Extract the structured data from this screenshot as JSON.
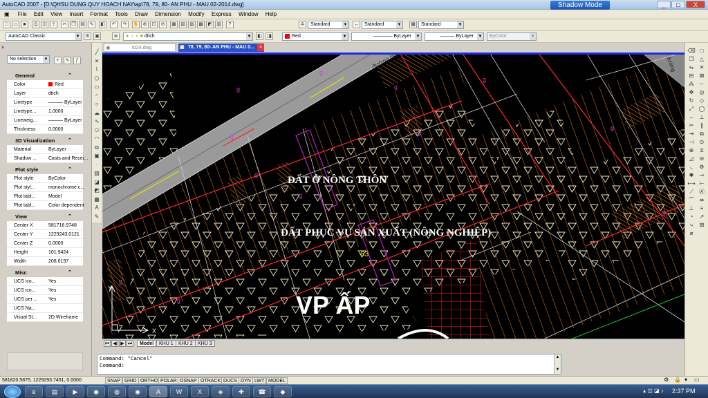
{
  "window": {
    "title": "AutoCAD 2007 - [D:\\QHSU DUNG QUY HOACH NAY\\ap\\78, 79, 80- AN PHU - MAU 02-2014.dwg]",
    "overlay": "Shadow Mode",
    "controls": [
      "_",
      "□",
      "X"
    ]
  },
  "menu": [
    "File",
    "Edit",
    "View",
    "Insert",
    "Format",
    "Tools",
    "Draw",
    "Dimension",
    "Modify",
    "Express",
    "Window",
    "Help"
  ],
  "toolbar1": {
    "text_style": "Standard",
    "dim_style": "Standard",
    "table_style": "Standard"
  },
  "toolbar2": {
    "workspace": "AutoCAD Classic",
    "layer": "dtich",
    "color": "Red",
    "linetype": "ByLayer",
    "lineweight": "ByLayer",
    "plotstyle": "ByColor"
  },
  "properties": {
    "selection": "No selection",
    "sections": [
      {
        "title": "General",
        "rows": [
          {
            "k": "Color",
            "v": "Red",
            "swatch": "#ff0000"
          },
          {
            "k": "Layer",
            "v": "dtich"
          },
          {
            "k": "Linetype",
            "v": "ByLayer",
            "line": true
          },
          {
            "k": "Linetype...",
            "v": "1.0000"
          },
          {
            "k": "Lineweig...",
            "v": "ByLayer",
            "line": true
          },
          {
            "k": "Thickness",
            "v": "0.0000"
          }
        ]
      },
      {
        "title": "3D Visualization",
        "rows": [
          {
            "k": "Material",
            "v": "ByLayer"
          },
          {
            "k": "Shadow ...",
            "v": "Casts and Recei..."
          }
        ]
      },
      {
        "title": "Plot style",
        "rows": [
          {
            "k": "Plot style",
            "v": "ByColor"
          },
          {
            "k": "Plot styl...",
            "v": "monochrome.c..."
          },
          {
            "k": "Plot tabl...",
            "v": "Model"
          },
          {
            "k": "Plot tabl...",
            "v": "Color dependent"
          }
        ]
      },
      {
        "title": "View",
        "rows": [
          {
            "k": "Center X",
            "v": "581716.9748"
          },
          {
            "k": "Center Y",
            "v": "1229243.0121"
          },
          {
            "k": "Center Z",
            "v": "0.0000"
          },
          {
            "k": "Height",
            "v": "101.9424"
          },
          {
            "k": "Width",
            "v": "208.0197"
          }
        ]
      },
      {
        "title": "Misc",
        "rows": [
          {
            "k": "UCS ico...",
            "v": "Yes"
          },
          {
            "k": "UCS ico...",
            "v": "Yes"
          },
          {
            "k": "UCS per ...",
            "v": "Yes"
          },
          {
            "k": "UCS Na...",
            "v": ""
          },
          {
            "k": "Visual St...",
            "v": "2D Wireframe"
          }
        ]
      }
    ]
  },
  "doc_tabs": [
    {
      "label": "to24.dwg",
      "active": false
    },
    {
      "label": "78, 79, 80- AN PHU - MAU 0...",
      "active": true
    }
  ],
  "drawing": {
    "road_label": "đường bê",
    "road_label_right": "đường",
    "zone1": "ĐẤT Ở NÔNG THÔN",
    "zone2": "ĐẤT PHỤC VỤ SẢN XUẤT (NÔNG NGHIỆP)",
    "lot_number": "63",
    "office": "VP ẤP",
    "lot_marker": "g",
    "ucs_y": "Y",
    "ucs_x": "X"
  },
  "layout_tabs": [
    "Model",
    "KHU 1",
    "KHU 2",
    "KHU 3"
  ],
  "command": {
    "line1": "Command: *Cancel*",
    "line2": "Command:"
  },
  "status": {
    "coords": "581820.5875, 1229293.7451, 0.0000",
    "toggles": [
      "SNAP",
      "GRID",
      "ORTHO",
      "POLAR",
      "OSNAP",
      "OTRACK",
      "DUCS",
      "DYN",
      "LWT",
      "MODEL"
    ]
  },
  "taskbar": {
    "clock": "2:37 PM"
  }
}
